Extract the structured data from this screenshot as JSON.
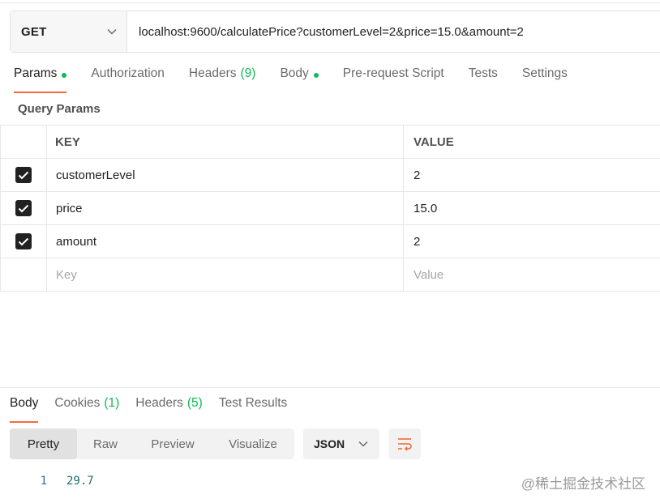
{
  "request": {
    "method": "GET",
    "url": "localhost:9600/calculatePrice?customerLevel=2&price=15.0&amount=2"
  },
  "request_tabs": {
    "params": "Params",
    "authorization": "Authorization",
    "headers": "Headers",
    "headers_count": "(9)",
    "body": "Body",
    "pre_request": "Pre-request Script",
    "tests": "Tests",
    "settings": "Settings"
  },
  "query_params": {
    "title": "Query Params",
    "key_header": "KEY",
    "value_header": "VALUE",
    "rows": [
      {
        "key": "customerLevel",
        "value": "2",
        "checked": true
      },
      {
        "key": "price",
        "value": "15.0",
        "checked": true
      },
      {
        "key": "amount",
        "value": "2",
        "checked": true
      }
    ],
    "key_placeholder": "Key",
    "value_placeholder": "Value"
  },
  "response_tabs": {
    "body": "Body",
    "cookies": "Cookies",
    "cookies_count": "(1)",
    "headers": "Headers",
    "headers_count": "(5)",
    "test_results": "Test Results"
  },
  "response_toolbar": {
    "views": [
      "Pretty",
      "Raw",
      "Preview",
      "Visualize"
    ],
    "active_view": "Pretty",
    "format": "JSON"
  },
  "response_body": {
    "line_number": "1",
    "content": "29.7"
  },
  "watermark": "@稀土掘金技术社区",
  "colors": {
    "accent": "#f26b3a",
    "green": "#0cbb52",
    "checkbox": "#212121"
  }
}
